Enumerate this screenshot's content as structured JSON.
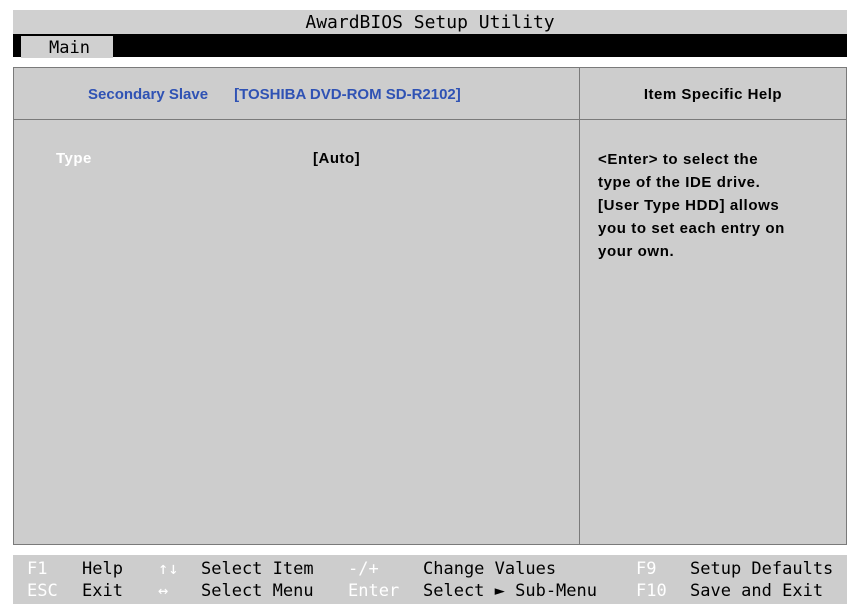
{
  "title": "AwardBIOS Setup Utility",
  "menu": {
    "active_tab": "Main"
  },
  "header": {
    "device_label": "Secondary Slave",
    "device_value": "[TOSHIBA DVD-ROM SD-R2102]",
    "help_title": "Item Specific Help"
  },
  "settings": [
    {
      "label": "Type",
      "value": "[Auto]"
    }
  ],
  "help_lines": [
    "<Enter> to select the",
    "type of the IDE drive.",
    "[User Type HDD] allows",
    "you to set each entry on",
    "your own."
  ],
  "footer": {
    "row1": [
      {
        "key": "F1",
        "label": "Help"
      },
      {
        "key": "↑↓",
        "label": "Select Item"
      },
      {
        "key": "-/+",
        "label": "Change Values"
      },
      {
        "key": "F9",
        "label": "Setup Defaults"
      }
    ],
    "row2": [
      {
        "key": "ESC",
        "label": "Exit"
      },
      {
        "key": "↔",
        "label": "Select Menu"
      },
      {
        "key": "Enter",
        "label": "Select ► Sub-Menu"
      },
      {
        "key": "F10",
        "label": "Save and Exit"
      }
    ]
  },
  "colors": {
    "background": "#cdcdcd",
    "header_accent": "#2f52b4",
    "selected_text": "#ffffff",
    "menu_bar": "#000000"
  }
}
